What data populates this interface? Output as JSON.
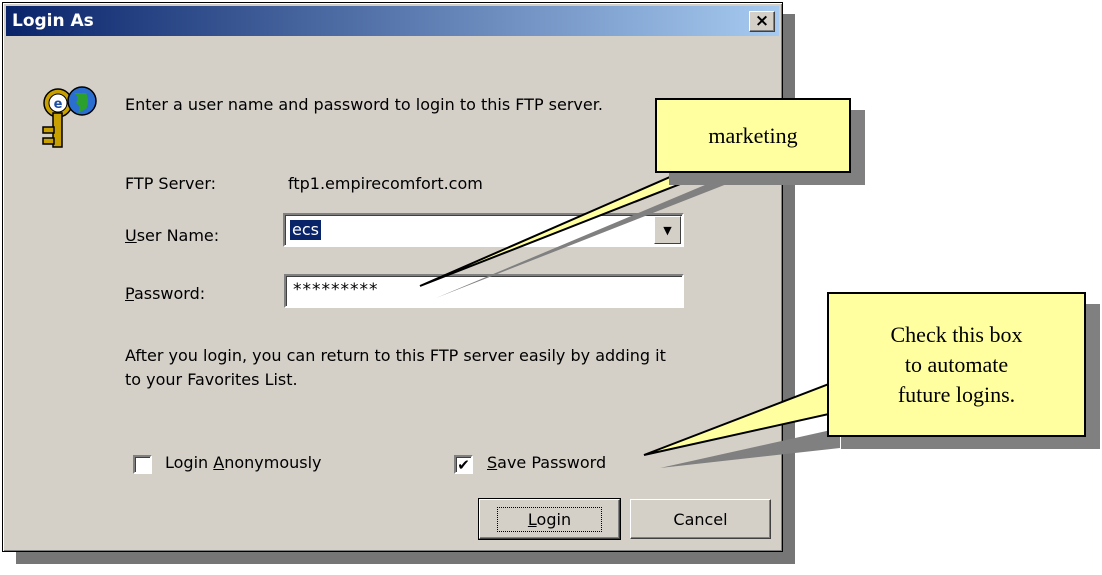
{
  "dialog": {
    "title": "Login As",
    "close_label": "×",
    "intro_text": "Enter a user name and password to login to this FTP server.",
    "ftp_server_label": "FTP Server:",
    "ftp_server_value": "ftp1.empirecomfort.com",
    "user_name_label_u": "U",
    "user_name_label_rest": "ser Name:",
    "user_name_value": "ecs",
    "password_label_u": "P",
    "password_label_rest": "assword:",
    "password_value": "*********",
    "info_text": "After you login, you can return to this FTP server easily by adding it to your Favorites List.",
    "login_anon_pre": "Login ",
    "login_anon_u": "A",
    "login_anon_rest": "nonymously",
    "login_anon_checked": false,
    "save_password_u": "S",
    "save_password_rest": "ave Password",
    "save_password_checked": true,
    "login_button_u": "L",
    "login_button_rest": "ogin",
    "cancel_button": "Cancel",
    "icon": "key-globe-icon"
  },
  "callouts": {
    "password_note": "marketing",
    "save_note_lines": [
      "Check this box",
      "to automate",
      "future logins."
    ]
  },
  "colors": {
    "title_bar_start": "#0a246a",
    "title_bar_end": "#a6caf0",
    "dialog_bg": "#d4d0c8",
    "callout_bg": "#ffffa0",
    "selection": "#0a246a"
  }
}
